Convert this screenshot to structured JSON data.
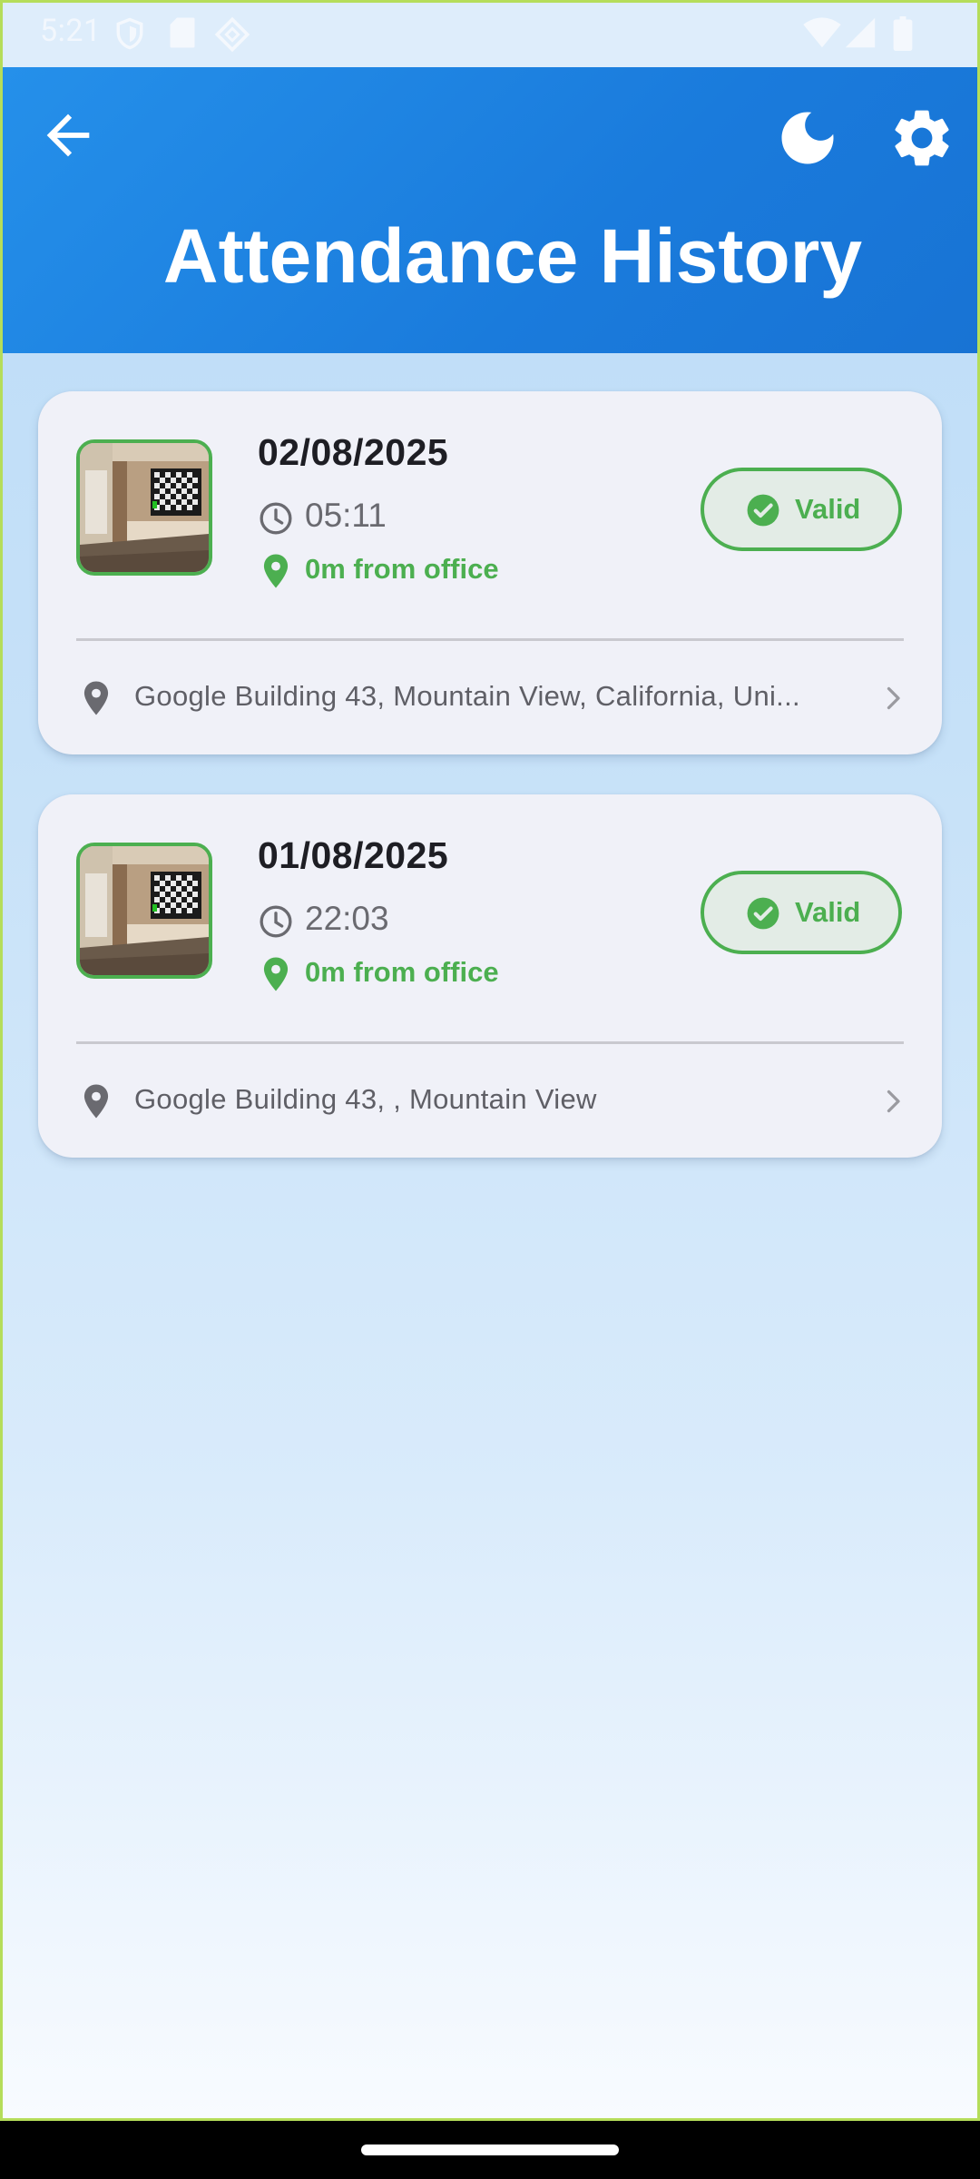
{
  "status_bar": {
    "time": "5:21",
    "icons": [
      "shield-icon",
      "sd-card-icon",
      "diamond-icon",
      "wifi-icon",
      "signal-icon",
      "battery-icon"
    ]
  },
  "app_bar": {
    "title": "Attendance History",
    "back_icon": "arrow-back-icon",
    "theme_icon": "moon-icon",
    "settings_icon": "gear-icon",
    "color": "#1e83e2"
  },
  "records": [
    {
      "date": "02/08/2025",
      "time": "05:11",
      "distance": "0m from office",
      "status": "Valid",
      "address": "Google Building 43, Mountain View, California, Uni..."
    },
    {
      "date": "01/08/2025",
      "time": "22:03",
      "distance": "0m from office",
      "status": "Valid",
      "address": "Google Building 43, , Mountain View"
    }
  ],
  "colors": {
    "valid_green": "#4caf50",
    "card_bg": "#f0f1f8"
  }
}
